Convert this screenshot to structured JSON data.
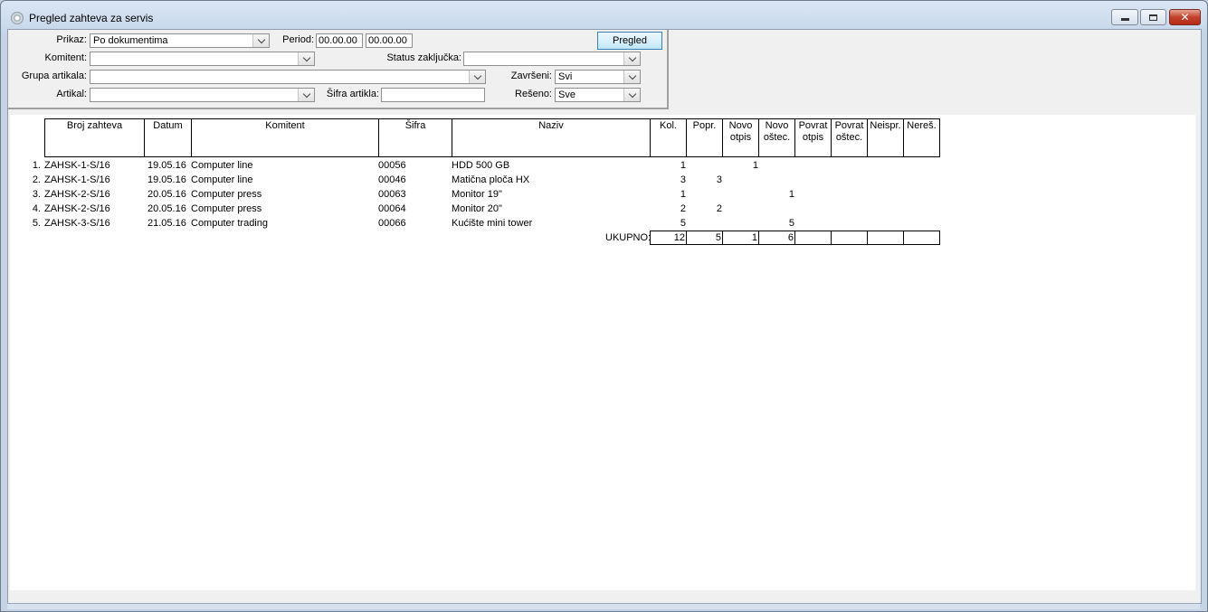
{
  "window": {
    "title": "Pregled zahteva za servis"
  },
  "filters": {
    "prikaz_label": "Prikaz:",
    "prikaz_value": "Po dokumentima",
    "period_label": "Period:",
    "period_from": "00.00.00",
    "period_to": "00.00.00",
    "pregled_button": "Pregled",
    "komitent_label": "Komitent:",
    "komitent_value": "",
    "status_label": "Status zaključka:",
    "status_value": "",
    "grupa_label": "Grupa artikala:",
    "grupa_value": "",
    "zavrseni_label": "Završeni:",
    "zavrseni_value": "Svi",
    "artikal_label": "Artikal:",
    "artikal_value": "",
    "sifra_label": "Šifra artikla:",
    "sifra_value": "",
    "reseno_label": "Rešeno:",
    "reseno_value": "Sve"
  },
  "table": {
    "headers": {
      "broj": "Broj zahteva",
      "datum": "Datum",
      "komitent": "Komitent",
      "sifra": "Šifra",
      "naziv": "Naziv",
      "kol": "Kol.",
      "popr": "Popr.",
      "novo_otpis_1": "Novo",
      "novo_otpis_2": "otpis",
      "novo_ostec_1": "Novo",
      "novo_ostec_2": "oštec.",
      "povrat_otpis_1": "Povrat",
      "povrat_otpis_2": "otpis",
      "povrat_ostec_1": "Povrat",
      "povrat_ostec_2": "oštec.",
      "neispr": "Neispr.",
      "neres": "Nereš."
    },
    "rows": [
      {
        "n": "1.",
        "broj": "ZAHSK-1-S/16",
        "datum": "19.05.16",
        "komitent": "Computer line",
        "sifra": "00056",
        "naziv": "HDD 500 GB",
        "kol": "1",
        "popr": "",
        "novo_otpis": "1",
        "novo_ostec": ""
      },
      {
        "n": "2.",
        "broj": "ZAHSK-1-S/16",
        "datum": "19.05.16",
        "komitent": "Computer line",
        "sifra": "00046",
        "naziv": "Matična ploča HX",
        "kol": "3",
        "popr": "3",
        "novo_otpis": "",
        "novo_ostec": ""
      },
      {
        "n": "3.",
        "broj": "ZAHSK-2-S/16",
        "datum": "20.05.16",
        "komitent": "Computer press",
        "sifra": "00063",
        "naziv": "Monitor 19\"",
        "kol": "1",
        "popr": "",
        "novo_otpis": "",
        "novo_ostec": "1"
      },
      {
        "n": "4.",
        "broj": "ZAHSK-2-S/16",
        "datum": "20.05.16",
        "komitent": "Computer press",
        "sifra": "00064",
        "naziv": "Monitor 20\"",
        "kol": "2",
        "popr": "2",
        "novo_otpis": "",
        "novo_ostec": ""
      },
      {
        "n": "5.",
        "broj": "ZAHSK-3-S/16",
        "datum": "21.05.16",
        "komitent": "Computer trading",
        "sifra": "00066",
        "naziv": "Kućište mini tower",
        "kol": "5",
        "popr": "",
        "novo_otpis": "",
        "novo_ostec": "5"
      }
    ],
    "totals": {
      "label": "UKUPNO:",
      "kol": "12",
      "popr": "5",
      "novo_otpis": "1",
      "novo_ostec": "6",
      "povrat_otpis": "",
      "povrat_ostec": "",
      "neispr": "",
      "neres": ""
    }
  }
}
